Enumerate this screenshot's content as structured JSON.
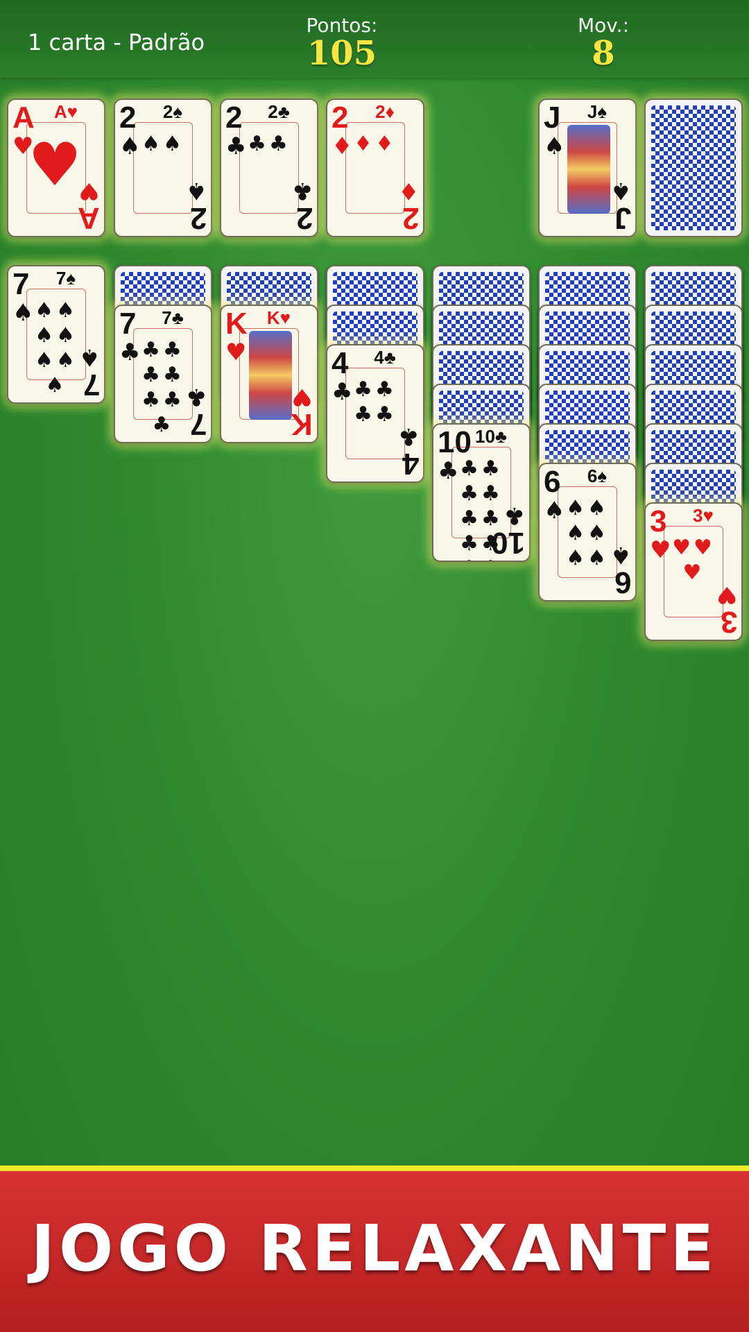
{
  "header": {
    "mode": "1 carta - Padrão",
    "score_label": "Pontos:",
    "score_value": "105",
    "moves_label": "Mov.:",
    "moves_value": "8"
  },
  "foundations": [
    {
      "rank": "A",
      "suit": "♥",
      "color": "red"
    },
    {
      "rank": "2",
      "suit": "♠",
      "color": "black"
    },
    {
      "rank": "2",
      "suit": "♣",
      "color": "black"
    },
    {
      "rank": "2",
      "suit": "♦",
      "color": "red"
    }
  ],
  "waste": {
    "rank": "J",
    "suit": "♠",
    "color": "black"
  },
  "stock": {
    "face": "down"
  },
  "tableau": [
    {
      "hidden": 0,
      "rank": "7",
      "suit": "♠",
      "color": "black"
    },
    {
      "hidden": 1,
      "rank": "7",
      "suit": "♣",
      "color": "black"
    },
    {
      "hidden": 1,
      "rank": "K",
      "suit": "♥",
      "color": "red"
    },
    {
      "hidden": 2,
      "rank": "4",
      "suit": "♣",
      "color": "black"
    },
    {
      "hidden": 4,
      "rank": "10",
      "suit": "♣",
      "color": "black"
    },
    {
      "hidden": 5,
      "rank": "6",
      "suit": "♠",
      "color": "black"
    },
    {
      "hidden": 6,
      "rank": "3",
      "suit": "♥",
      "color": "red"
    }
  ],
  "banner": {
    "text": "JOGO RELAXANTE"
  }
}
